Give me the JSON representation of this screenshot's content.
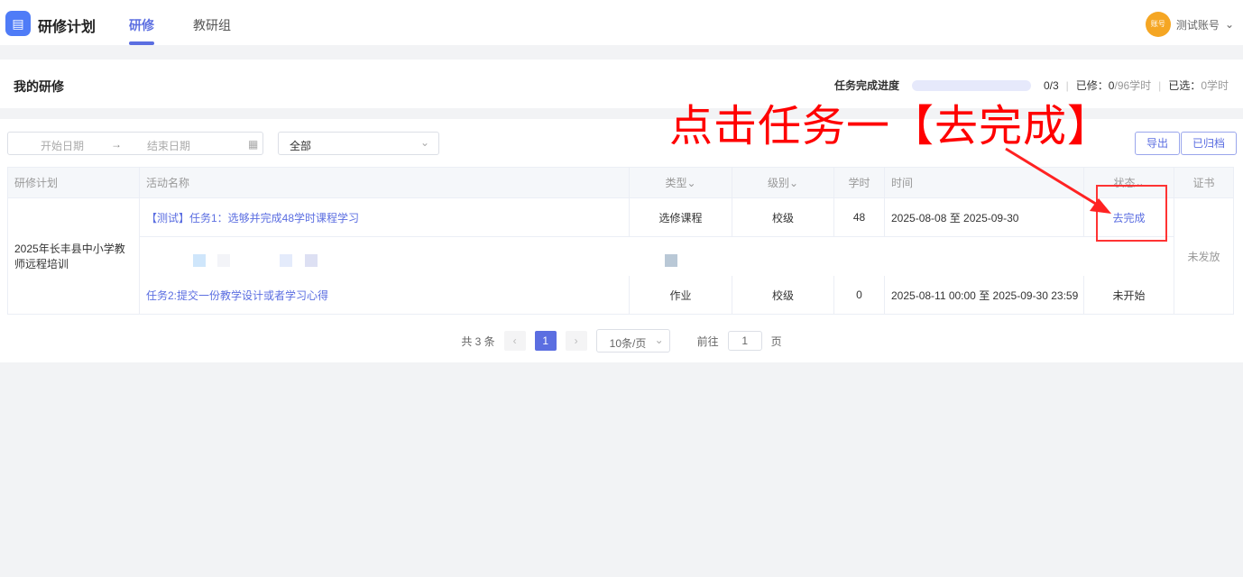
{
  "nav": {
    "app_title": "研修计划",
    "tabs": [
      {
        "label": "研修",
        "active": true
      },
      {
        "label": "教研组",
        "active": false
      }
    ],
    "user": {
      "avatar_text": "账号",
      "name": "测试账号"
    }
  },
  "header": {
    "title": "我的研修",
    "progress_label": "任务完成进度",
    "progress_value": 0,
    "progress_count": "0/3",
    "studied_label": "已修：",
    "studied_value": "0",
    "studied_total": "/96学时",
    "selected_label": "已选：",
    "selected_value": "0学时"
  },
  "filters": {
    "start_placeholder": "开始日期",
    "end_placeholder": "结束日期",
    "arrow": "→",
    "select_value": "全部",
    "export_label": "导出",
    "archived_label": "已归档"
  },
  "table": {
    "headers": [
      "研修计划",
      "活动名称",
      "类型",
      "级别",
      "学时",
      "时间",
      "状态",
      "证书"
    ],
    "plan": "2025年长丰县中小学教师远程培训",
    "certificate": "未发放",
    "rows": [
      {
        "name": "【测试】任务1：选够并完成48学时课程学习",
        "type": "选修课程",
        "level": "校级",
        "hours": "48",
        "time": "2025-08-08 至 2025-09-30",
        "status": "去完成",
        "status_link": true
      },
      {
        "name": "",
        "type": "",
        "level": "",
        "hours": "",
        "time": "",
        "status": ""
      },
      {
        "name": "任务2:提交一份教学设计或者学习心得",
        "type": "作业",
        "level": "校级",
        "hours": "0",
        "time": "2025-08-11 00:00 至 2025-09-30 23:59",
        "status": "未开始"
      }
    ]
  },
  "pagination": {
    "total": "共 3 条",
    "current": "1",
    "page_size": "10条/页",
    "goto_label": "前往",
    "goto_value": "1",
    "page_unit": "页"
  },
  "annotation": {
    "text": "点击任务一【去完成】",
    "color": "#ff0000"
  },
  "colors": {
    "accent": "#5b6ee1",
    "avatar": "#f5a623"
  }
}
